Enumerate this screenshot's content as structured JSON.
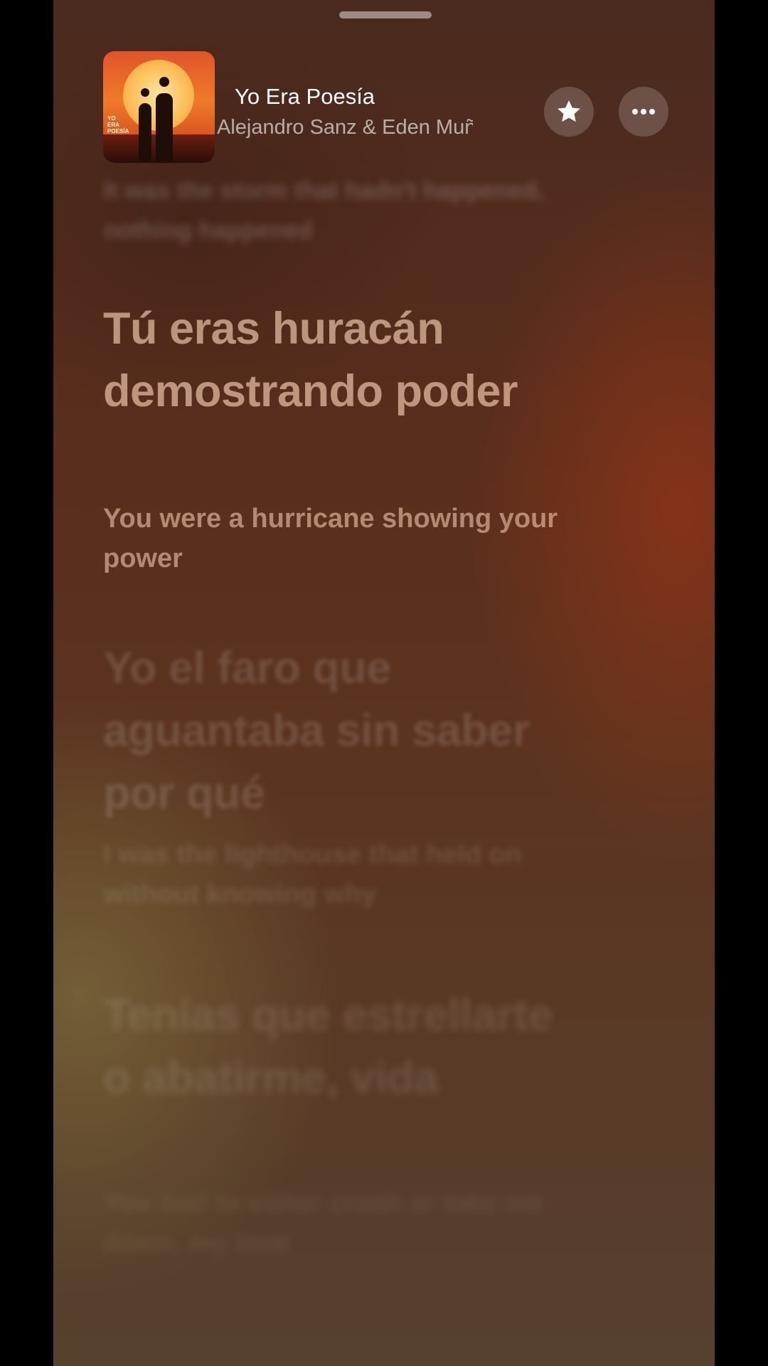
{
  "header": {
    "title": "Yo Era Poesía",
    "artist": "Alejandro Sanz & Eden Muñoz",
    "artwork_text": "YO ERA POESÍA"
  },
  "icons": {
    "star": "star-icon",
    "more": "ellipsis-icon",
    "handle": "drag-handle"
  },
  "lyrics": {
    "previous": "It was the storm that hadn't happened, nothing happened",
    "active": {
      "main": "Tú eras huracán demostrando poder",
      "translation": "You were a hurricane showing your power"
    },
    "next1": {
      "main": "Yo el faro que aguantaba sin saber por qué",
      "translation": "I was the lighthouse that held on without knowing why"
    },
    "next2": {
      "main": "Tenías que estrellarte o abatirme, vida",
      "translation": "You had to either crash or take me down, my love"
    }
  }
}
